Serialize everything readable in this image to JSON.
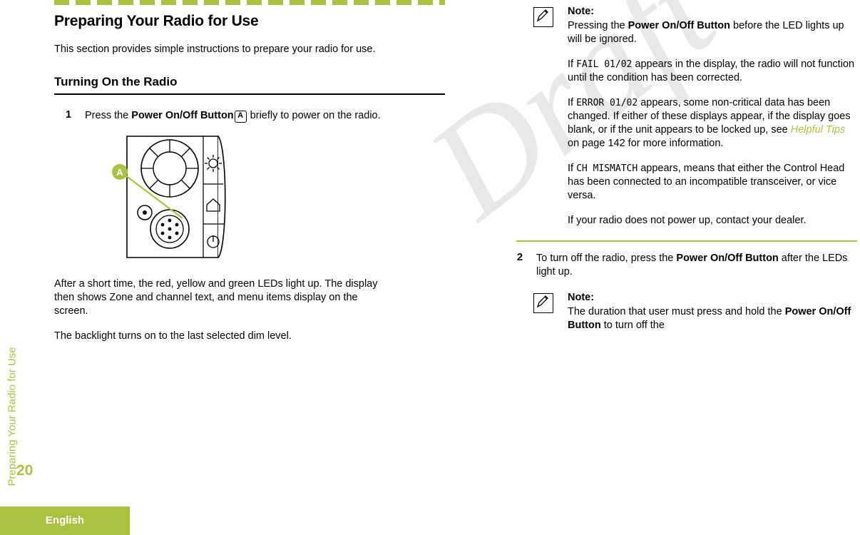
{
  "document": {
    "sidebar_tab_label": "Preparing Your Radio for Use",
    "page_number": "20",
    "footer_language": "English",
    "watermark": "Draft"
  },
  "left_column": {
    "chapter_title": "Preparing Your Radio for Use",
    "intro_paragraph": "This section provides simple instructions to prepare your radio for use.",
    "section_title": "Turning On the Radio",
    "step1": {
      "number": "1",
      "text_before": "Press the ",
      "bold_label": "Power On/Off Button",
      "callout_letter": "A",
      "text_after": " briefly to power on the radio."
    },
    "after_figure_paragraph": "After a short time, the red, yellow and green LEDs light up. The display then shows Zone and channel text, and menu items display on the screen.",
    "backlight_paragraph": "The backlight turns on to the last selected dim level."
  },
  "right_column": {
    "note1": {
      "title": "Note:",
      "p1_pre": "Pressing the ",
      "p1_bold": "Power On/Off Button",
      "p1_post": " before the LED lights up will be ignored.",
      "p2_pre": "If ",
      "p2_mono": "FAIL 01/02",
      "p2_post": " appears in the display, the radio will not function until the condition has been corrected.",
      "p3_pre": "If ",
      "p3_mono": "ERROR 01/02",
      "p3_mid": " appears, some non-critical data has been changed. If either of these displays appear, if the display goes blank, or if the unit appears to be locked up, see ",
      "p3_link": "Helpful Tips",
      "p3_post": " on page 142 for more information.",
      "p4_pre": "If ",
      "p4_mono": "CH MISMATCH",
      "p4_post": " appears, means that either the Control Head has been connected to an incompatible transceiver, or vice versa.",
      "p5": "If your radio does not power up, contact your dealer."
    },
    "step2": {
      "number": "2",
      "text_pre": "To turn off the radio, press the ",
      "bold_label": "Power On/Off Button",
      "text_post": " after the LEDs light up."
    },
    "note2": {
      "title": "Note:",
      "p1_pre": "The duration that user must press and hold the ",
      "p1_bold": "Power On/Off Button",
      "p1_post": " to turn off the"
    }
  },
  "colors": {
    "accent_green": "#a9c23f",
    "text": "#000000"
  }
}
